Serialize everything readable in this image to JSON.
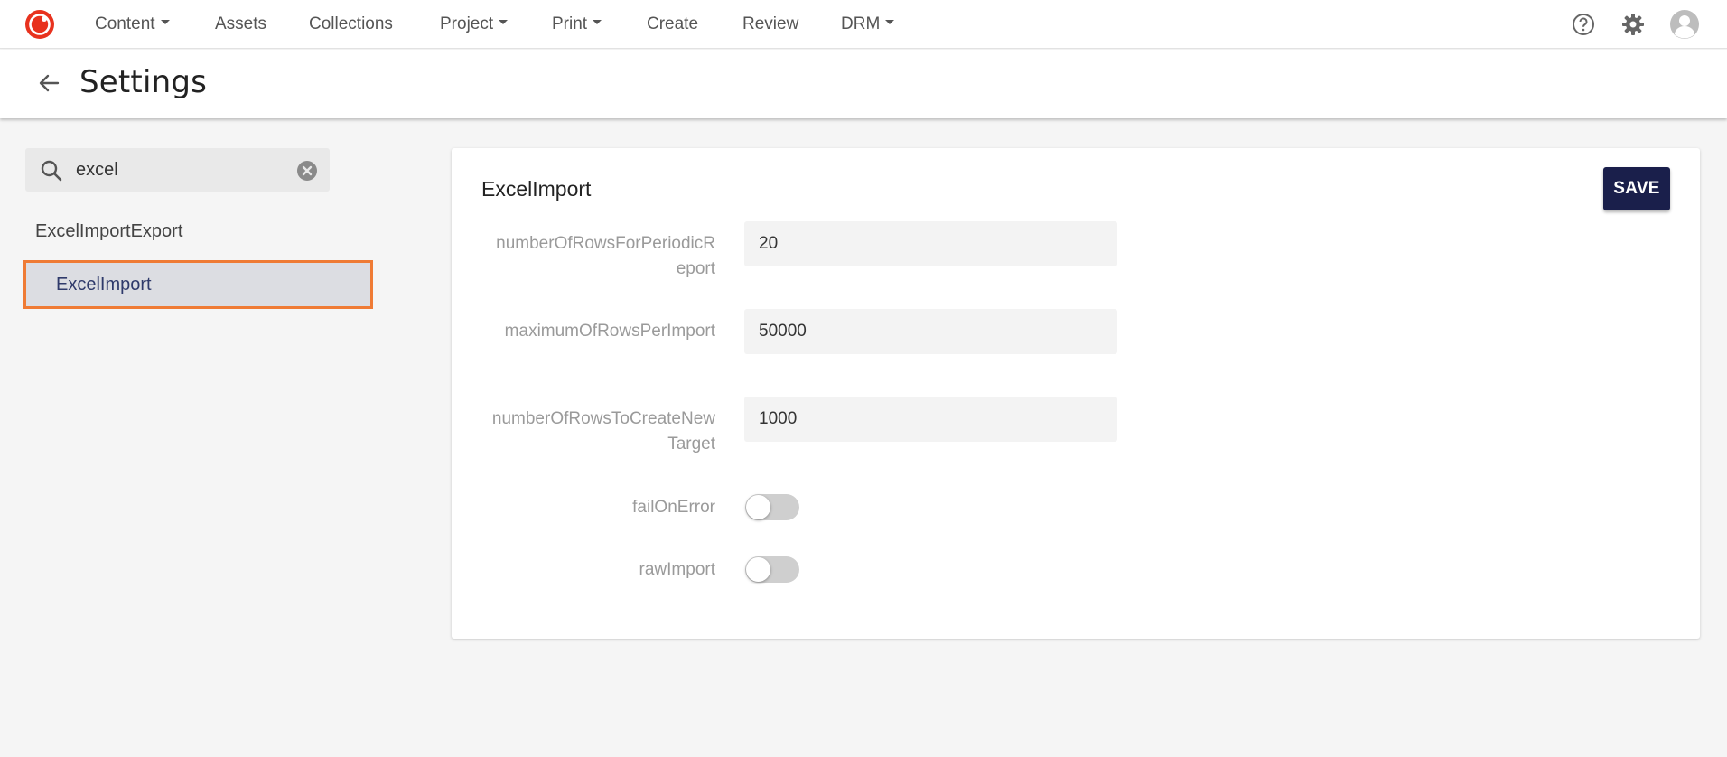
{
  "nav": {
    "items": [
      {
        "label": "Content",
        "dropdown": true
      },
      {
        "label": "Assets",
        "dropdown": false
      },
      {
        "label": "Collections",
        "dropdown": false
      },
      {
        "label": "Project",
        "dropdown": true
      },
      {
        "label": "Print",
        "dropdown": true
      },
      {
        "label": "Create",
        "dropdown": false
      },
      {
        "label": "Review",
        "dropdown": false
      },
      {
        "label": "DRM",
        "dropdown": true
      }
    ],
    "icons": [
      "help-icon",
      "gear-icon",
      "user-avatar-icon"
    ],
    "brand_color": "#e8321e"
  },
  "header": {
    "title": "Settings"
  },
  "sidebar": {
    "search": {
      "value": "excel",
      "placeholder": ""
    },
    "tree": {
      "parent": "ExcelImportExport",
      "selected_child": "ExcelImport",
      "highlight_color": "#ef7b35"
    }
  },
  "main": {
    "section_title": "ExcelImport",
    "save_label": "SAVE",
    "fields": [
      {
        "label": "numberOfRowsForPeriodicReport",
        "value": "20"
      },
      {
        "label": "maximumOfRowsPerImport",
        "value": "50000"
      },
      {
        "label": "numberOfRowsToCreateNewTarget",
        "value": "1000"
      }
    ],
    "toggles": [
      {
        "label": "failOnError",
        "on": false
      },
      {
        "label": "rawImport",
        "on": false
      }
    ]
  }
}
